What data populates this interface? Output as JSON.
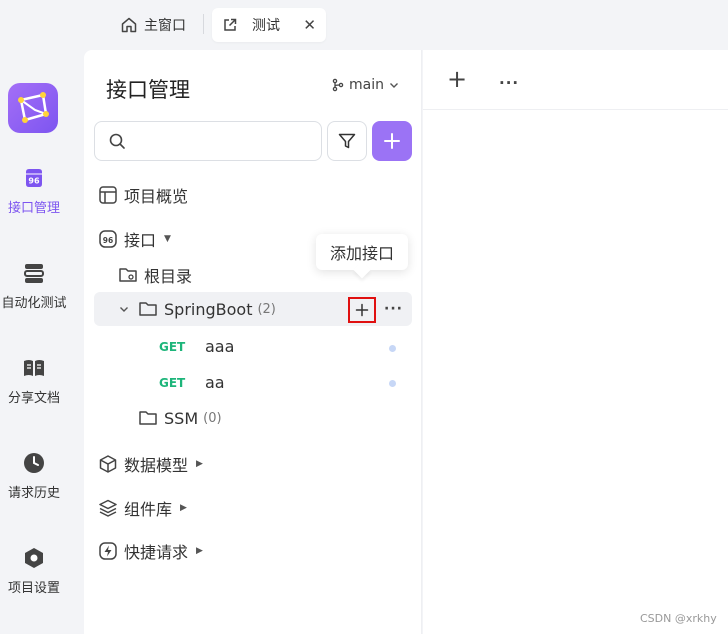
{
  "tabs": {
    "home_label": "主窗口",
    "active_label": "测试",
    "close_glyph": "✕"
  },
  "rail": {
    "items": [
      {
        "label": "接口管理",
        "icon": "api-icon",
        "active": true
      },
      {
        "label": "自动化测试",
        "icon": "automation-icon",
        "active": false
      },
      {
        "label": "分享文档",
        "icon": "book-icon",
        "active": false
      },
      {
        "label": "请求历史",
        "icon": "clock-icon",
        "active": false
      },
      {
        "label": "项目设置",
        "icon": "settings-hex-icon",
        "active": false
      }
    ]
  },
  "panel": {
    "title": "接口管理",
    "branch": "main",
    "search_placeholder": "",
    "tree": {
      "overview": "项目概览",
      "apis": "接口",
      "root": "根目录",
      "springboot": {
        "name": "SpringBoot",
        "count": "(2)"
      },
      "endpoints": [
        {
          "method": "GET",
          "name": "aaa"
        },
        {
          "method": "GET",
          "name": "aa"
        }
      ],
      "ssm": {
        "name": "SSM",
        "count": "(0)"
      },
      "schemas": "数据模型",
      "components": "组件库",
      "quick": "快捷请求"
    },
    "tooltip": "添加接口"
  },
  "main": {
    "plus_glyph": "+",
    "more_glyph": "···"
  },
  "watermark": "CSDN @xrkhy",
  "colors": {
    "accent": "#7d55f0",
    "get": "#1db57a",
    "highlight_border": "#e01010"
  }
}
